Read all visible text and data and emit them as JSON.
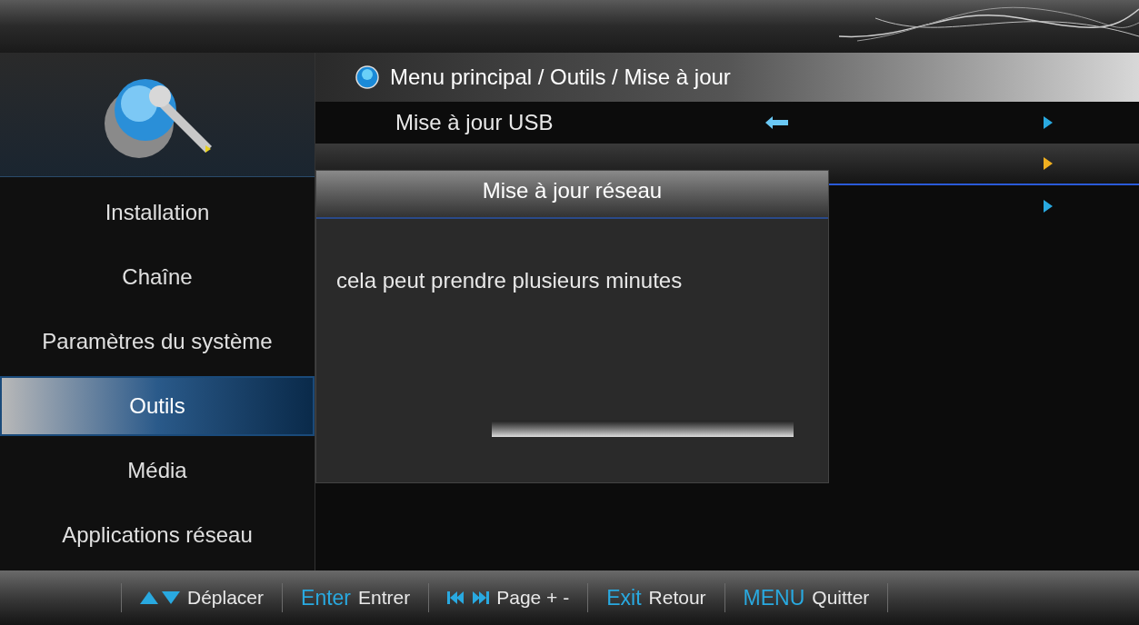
{
  "breadcrumb": "Menu principal / Outils / Mise à jour",
  "sidebar": {
    "items": [
      {
        "label": "Installation",
        "selected": false
      },
      {
        "label": "Chaîne",
        "selected": false
      },
      {
        "label": "Paramètres du système",
        "selected": false
      },
      {
        "label": "Outils",
        "selected": true
      },
      {
        "label": "Média",
        "selected": false
      },
      {
        "label": "Applications réseau",
        "selected": false
      }
    ]
  },
  "menu": {
    "items": [
      {
        "label": "Mise à jour USB",
        "selected": false,
        "current": true
      },
      {
        "selected": true
      },
      {
        "selected": false
      }
    ]
  },
  "dialog": {
    "title": "Mise à jour réseau",
    "message": "cela peut prendre plusieurs minutes",
    "progress": {
      "level": 0
    }
  },
  "footer": {
    "hints": [
      {
        "kind": "updown",
        "label": "Déplacer"
      },
      {
        "kind": "key",
        "key": "Enter",
        "label": "Entrer"
      },
      {
        "kind": "skip",
        "label": "Page + -"
      },
      {
        "kind": "key",
        "key": "Exit",
        "label": "Retour"
      },
      {
        "kind": "key",
        "key": "MENU",
        "label": "Quitter"
      }
    ]
  }
}
